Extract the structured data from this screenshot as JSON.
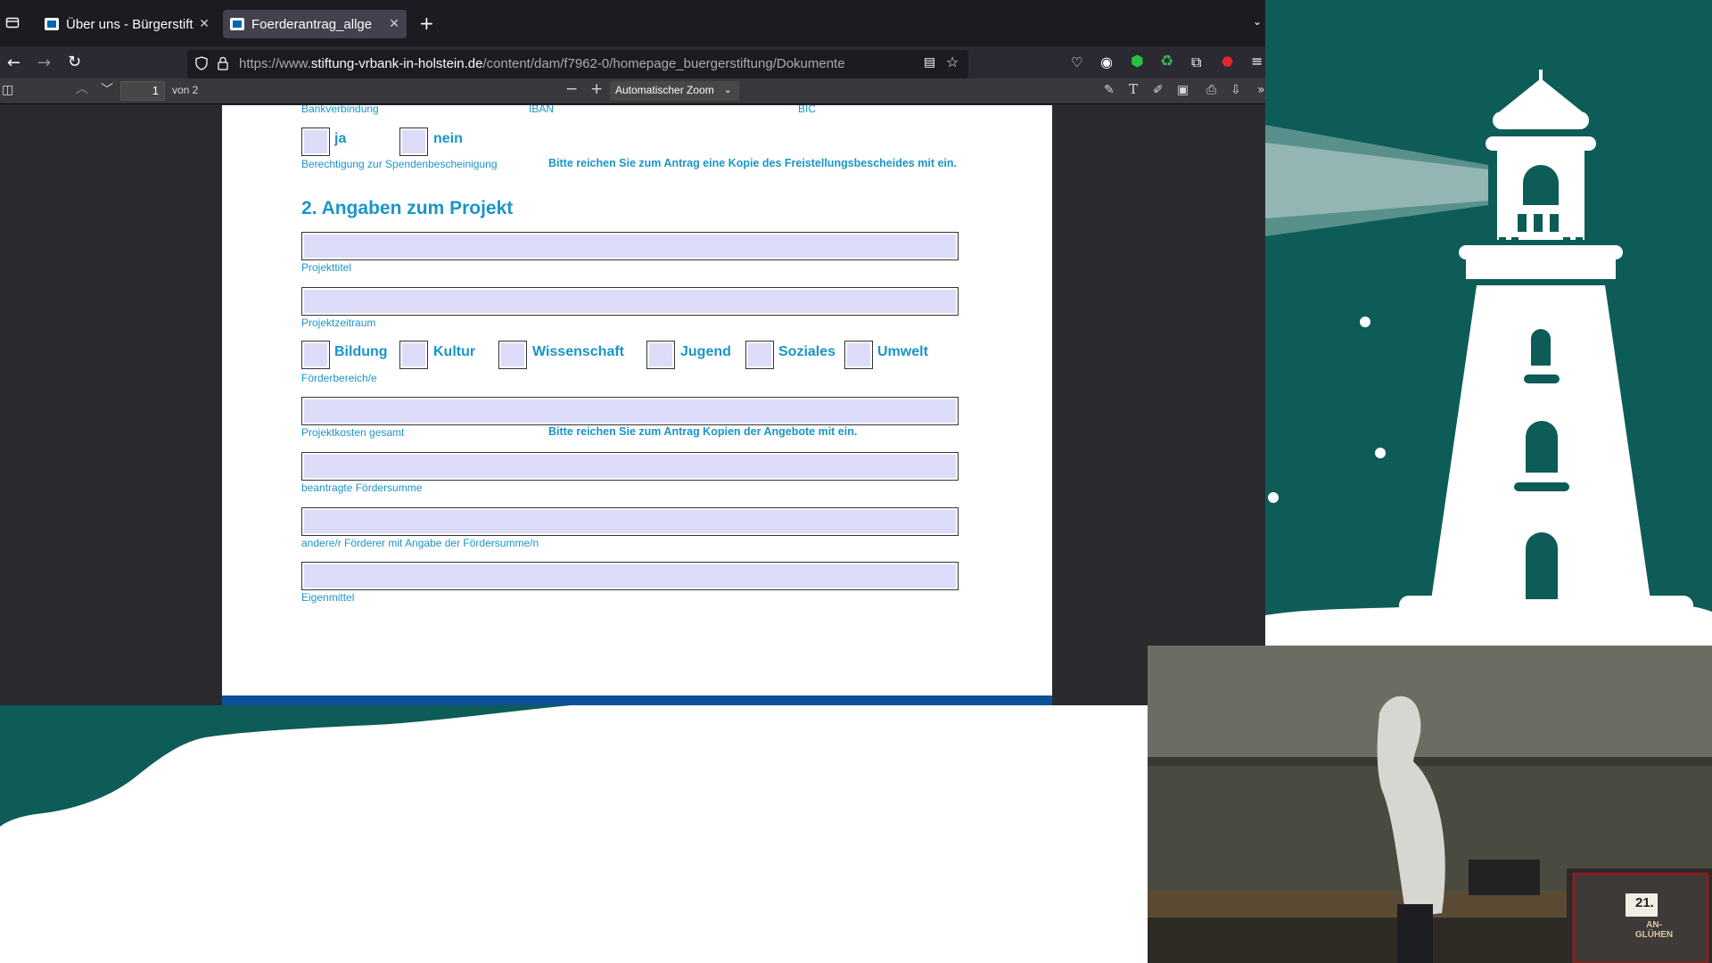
{
  "browser": {
    "tabs": [
      {
        "title": "Über uns - Bürgerstift",
        "active": false
      },
      {
        "title": "Foerderantrag_allge",
        "active": true
      }
    ],
    "url": {
      "prefix": "https://www.",
      "domain": "stiftung-vrbank-in-holstein.de",
      "path": "/content/dam/f7962-0/homepage_buergerstiftung/Dokumente"
    }
  },
  "pdf_toolbar": {
    "page_number": "1",
    "page_of": "von 2",
    "zoom": "Automatischer Zoom"
  },
  "form": {
    "bank_labels": [
      "Bankverbindung",
      "IBAN",
      "BIC"
    ],
    "donation": {
      "yes": "ja",
      "no": "nein",
      "label": "Berechtigung zur Spendenbescheinigung",
      "note": "Bitte reichen Sie zum Antrag eine Kopie des Freistellungsbescheides mit ein."
    },
    "section_title": "2. Angaben zum Projekt",
    "project_title_label": "Projekttitel",
    "project_period_label": "Projektzeitraum",
    "funding_areas": [
      "Bildung",
      "Kultur",
      "Wissenschaft",
      "Jugend",
      "Soziales",
      "Umwelt"
    ],
    "funding_area_label": "Förderbereich/e",
    "total_cost_label": "Projektkosten gesamt",
    "total_cost_note": "Bitte reichen Sie zum Antrag Kopien der Angebote mit ein.",
    "requested_label": "beantragte Fördersumme",
    "other_funders_label": "andere/r Förderer mit Angabe der Fördersumme/n",
    "own_funds_label": "Eigenmittel"
  },
  "webcam": {
    "calendar_number": "21.",
    "calendar_text": "AN-\nGLÜHEN"
  },
  "colors": {
    "slide_green": "#0d5c57",
    "form_blue": "#1a95c9",
    "field_fill": "#dcdcf8",
    "pdf_footer": "#0d4f98"
  }
}
